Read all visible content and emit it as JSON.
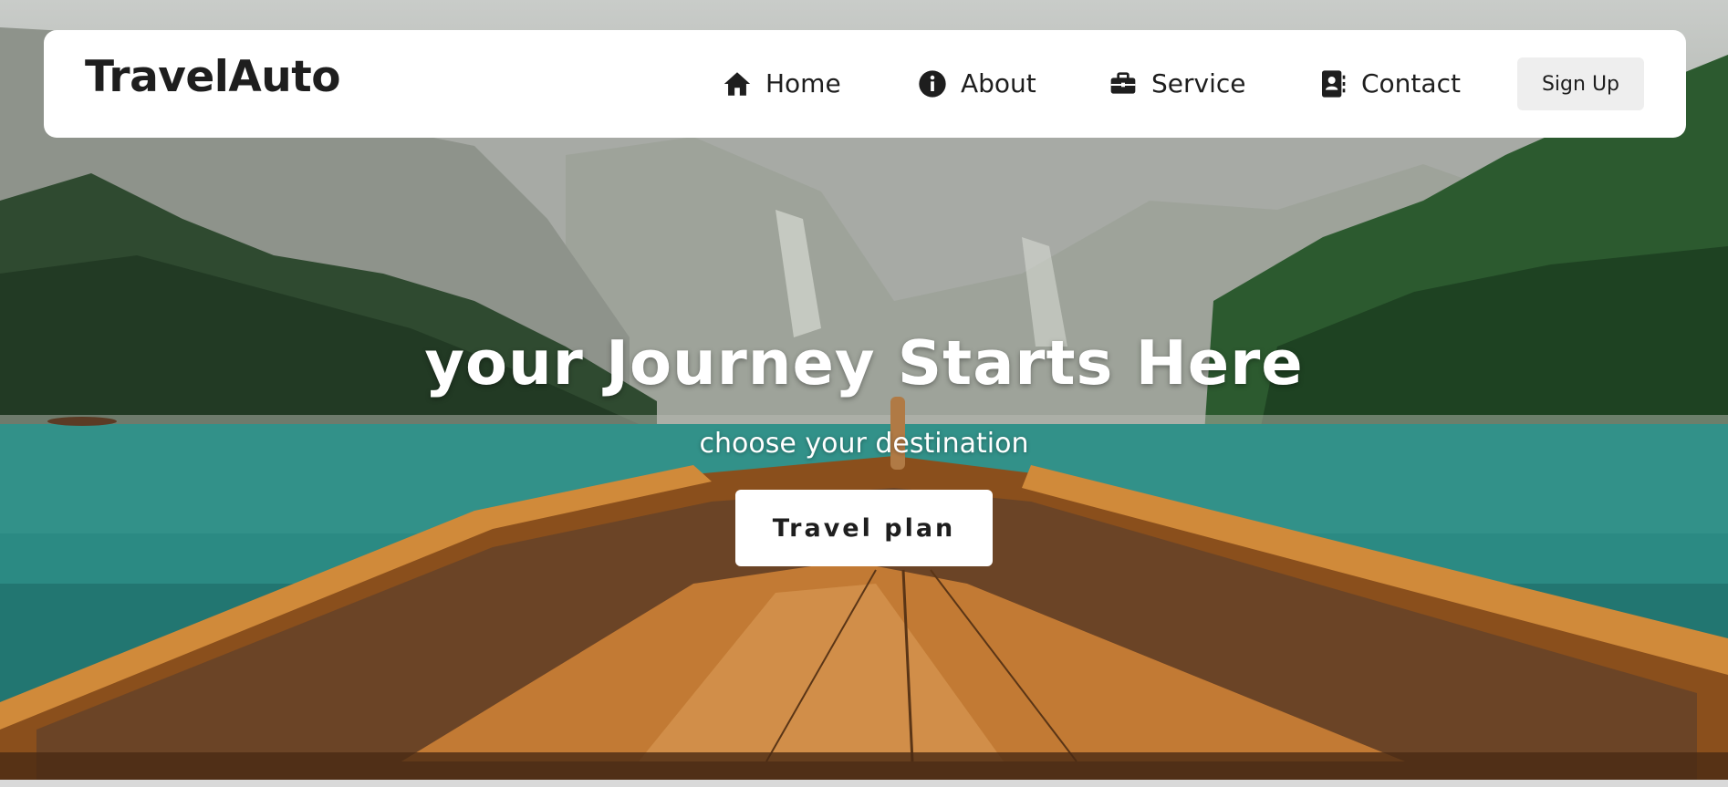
{
  "nav": {
    "brand": "TravelAuto",
    "items": [
      {
        "label": "Home",
        "icon": "home-icon"
      },
      {
        "label": "About",
        "icon": "info-circle-icon"
      },
      {
        "label": "Service",
        "icon": "briefcase-icon"
      },
      {
        "label": "Contact",
        "icon": "contact-card-icon"
      }
    ],
    "signup_label": "Sign Up"
  },
  "hero": {
    "title": "your Journey Starts Here",
    "subtitle": "choose your destination",
    "cta_label": "Travel plan",
    "background": "mountain-lake-boat-photo"
  },
  "colors": {
    "text": "#1e1e1e",
    "navbar_bg": "#ffffff",
    "signup_bg": "#eeeeee",
    "lake": "#2b8a83",
    "wood": "#b8742e"
  }
}
